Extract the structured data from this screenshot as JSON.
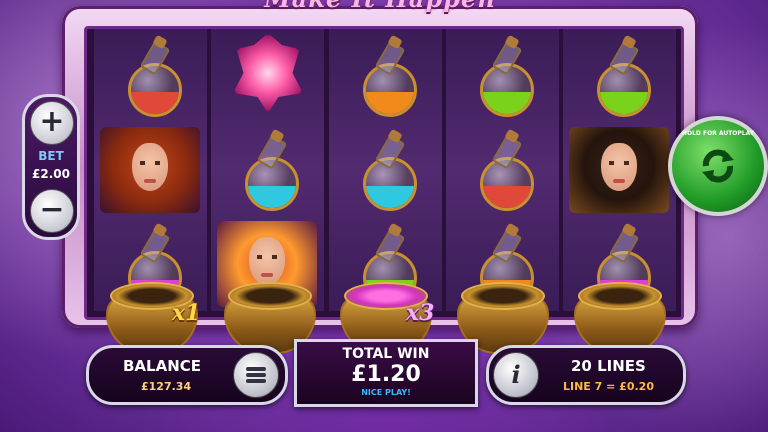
{
  "game": {
    "title": "Make It Happen"
  },
  "bet_panel": {
    "increase_label": "+",
    "bet_label": "BET",
    "bet_value": "£2.00",
    "decrease_label": "−"
  },
  "spin": {
    "caption": "HOLD FOR AUTOPLAY",
    "icon": "refresh-arrows-icon",
    "color": "#1f9a26"
  },
  "reels": [
    [
      "potion-red",
      "portrait-redhead",
      "potion-pink"
    ],
    [
      "pink-crystal",
      "potion-cyan",
      "portrait-redhead-fire"
    ],
    [
      "potion-orange",
      "potion-cyan",
      "potion-green"
    ],
    [
      "potion-green",
      "potion-red",
      "potion-orange"
    ],
    [
      "potion-green",
      "portrait-brunette",
      "potion-pink"
    ]
  ],
  "potion_colors": {
    "red": "#e0483a",
    "pink": "#e040d8",
    "cyan": "#2ec8e0",
    "orange": "#f08a1a",
    "green": "#7ad21a"
  },
  "cauldrons": [
    {
      "filled": false,
      "multiplier": "x1"
    },
    {
      "filled": false,
      "multiplier": ""
    },
    {
      "filled": true,
      "multiplier": "x3"
    },
    {
      "filled": false,
      "multiplier": ""
    },
    {
      "filled": false,
      "multiplier": ""
    }
  ],
  "balance": {
    "label": "BALANCE",
    "value": "£127.34",
    "menu_icon": "hamburger-menu-icon"
  },
  "total_win": {
    "label": "TOTAL WIN",
    "value": "£1.20",
    "message": "NICE PLAY!"
  },
  "lines": {
    "label": "20 LINES",
    "detail": "LINE 7 = £0.20",
    "info_icon": "info-icon",
    "info_glyph": "i"
  }
}
